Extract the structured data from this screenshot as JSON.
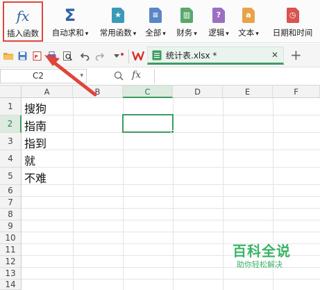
{
  "ribbon": {
    "insert_fn_label": "插入函数",
    "autosum_label": "自动求和",
    "common_fn_label": "常用函数",
    "all_label": "全部",
    "finance_label": "财务",
    "logic_label": "逻辑",
    "text_label": "文本",
    "datetime_label": "日期和时间",
    "dropdown_glyph": "▾",
    "fx_glyph": "fx",
    "sigma_glyph": "Σ",
    "logic_glyph": "?",
    "text_glyph": "a"
  },
  "toolbar": {
    "file_tab_name": "统计表.xlsx *",
    "close_glyph": "✕",
    "new_tab_glyph": "+"
  },
  "formula_bar": {
    "cell_ref": "C2",
    "fx_glyph": "fx",
    "content": ""
  },
  "sheet": {
    "columns": [
      "A",
      "B",
      "C",
      "D",
      "E",
      "F"
    ],
    "rows": [
      "1",
      "2",
      "3",
      "4",
      "5",
      "6",
      "7",
      "8",
      "9",
      "10",
      "11",
      "12",
      "13",
      "14"
    ],
    "active_cell": "C2",
    "cells": {
      "A1": "搜狗",
      "A2": "指南",
      "A3": "指到",
      "A4": "就",
      "A5": "不难"
    }
  },
  "watermark": {
    "title": "百科全说",
    "subtitle": "助你轻松解决"
  },
  "colors": {
    "accent_green": "#3b9c5f",
    "highlight_red": "#e0443a",
    "watermark_green": "#39b465"
  }
}
